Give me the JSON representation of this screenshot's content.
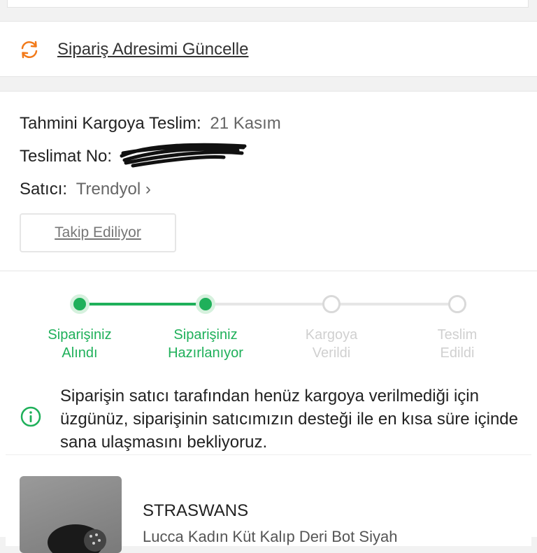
{
  "update_address": {
    "label": "Sipariş Adresimi Güncelle",
    "icon": "refresh-icon"
  },
  "delivery_info": {
    "estimated_label": "Tahmini Kargoya Teslim:",
    "estimated_value": "21 Kasım",
    "delivery_no_label": "Teslimat No:",
    "seller_label": "Satıcı:",
    "seller_value": "Trendyol",
    "follow_button": "Takip Ediliyor"
  },
  "progress": {
    "steps": [
      {
        "label_line1": "Siparişiniz",
        "label_line2": "Alındı",
        "state": "done"
      },
      {
        "label_line1": "Siparişiniz",
        "label_line2": "Hazırlanıyor",
        "state": "done"
      },
      {
        "label_line1": "Kargoya",
        "label_line2": "Verildi",
        "state": "pending"
      },
      {
        "label_line1": "Teslim",
        "label_line2": "Edildi",
        "state": "pending"
      }
    ],
    "colors": {
      "active": "#1fb05a",
      "inactive": "#d9d9d9"
    }
  },
  "notice": {
    "text": "Siparişin satıcı tarafından henüz kargoya verilmediği için üzgünüz, siparişinin satıcımızın desteği ile en kısa süre içinde sana ulaşmasını bekliyoruz.",
    "icon": "info-icon"
  },
  "product": {
    "brand": "STRASWANS",
    "name": "Lucca Kadın Küt Kalıp Deri Bot Siyah"
  },
  "accent_color": "#f27a1a"
}
